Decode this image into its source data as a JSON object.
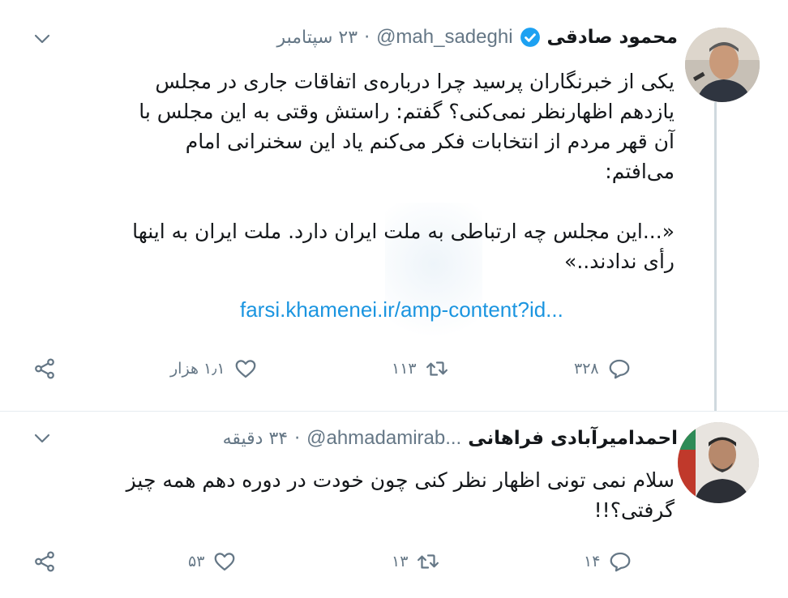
{
  "tweets": [
    {
      "name": "محمود صادقی",
      "handle": "@mah_sadeghi",
      "separator": "·",
      "time": "۲۳ سپتامبر",
      "verified": true,
      "text_lines": [
        "یکی از خبرنگاران پرسید چرا درباره‌ی اتفاقات جاری در مجلس",
        "یازدهم اظهارنظر نمی‌کنی؟ گفتم: راستش وقتی به این مجلس با",
        "آن قهر مردم از انتخابات فکر می‌کنم یاد این سخنرانی امام",
        "می‌افتم:",
        "",
        "«...این مجلس چه ارتباطی به ملت ایران دارد. ملت ایران به اینها",
        "رأی ندادند..»"
      ],
      "link": "farsi.khamenei.ir/amp-content?id...",
      "stats": {
        "replies": "۳۲۸",
        "retweets": "۱۱۳",
        "likes": "۱٫۱ هزار"
      }
    },
    {
      "name": "احمدامیرآبادی فراهانی",
      "handle": "@ahmadamirab...",
      "separator": "·",
      "time": "۳۴ دقیقه",
      "verified": false,
      "text_lines": [
        "سلام نمی تونی اظهار نظر کنی چون خودت در دوره دهم همه چیز",
        "گرفتی؟!!"
      ],
      "stats": {
        "replies": "۱۴",
        "retweets": "۱۳",
        "likes": "۵۳"
      }
    }
  ],
  "colors": {
    "accent": "#1da1f2",
    "link": "#1b95e0",
    "muted": "#657786",
    "divider": "#e6ecf0"
  },
  "icons": [
    "chevron-down-icon",
    "verified-badge-icon",
    "reply-icon",
    "retweet-icon",
    "like-icon",
    "share-icon"
  ]
}
